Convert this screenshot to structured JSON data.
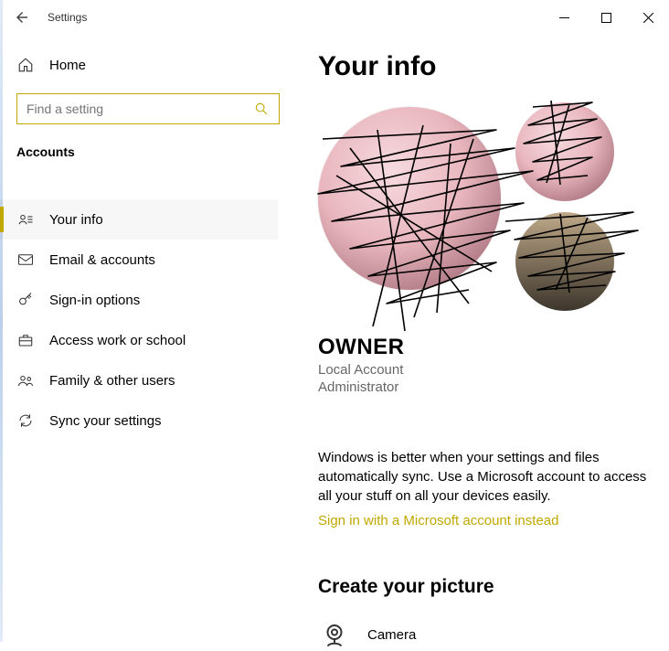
{
  "window": {
    "title": "Settings"
  },
  "sidebar": {
    "home_label": "Home",
    "search_placeholder": "Find a setting",
    "category_label": "Accounts",
    "items": [
      {
        "label": "Your info"
      },
      {
        "label": "Email & accounts"
      },
      {
        "label": "Sign-in options"
      },
      {
        "label": "Access work or school"
      },
      {
        "label": "Family & other users"
      },
      {
        "label": "Sync your settings"
      }
    ]
  },
  "main": {
    "page_title": "Your info",
    "user_name": "OWNER",
    "account_type": "Local Account",
    "account_role": "Administrator",
    "sync_message": "Windows is better when your settings and files automatically sync. Use a Microsoft account to access all your stuff on all your devices easily.",
    "ms_link": "Sign in with a Microsoft account instead",
    "create_picture_heading": "Create your picture",
    "camera_label": "Camera"
  }
}
